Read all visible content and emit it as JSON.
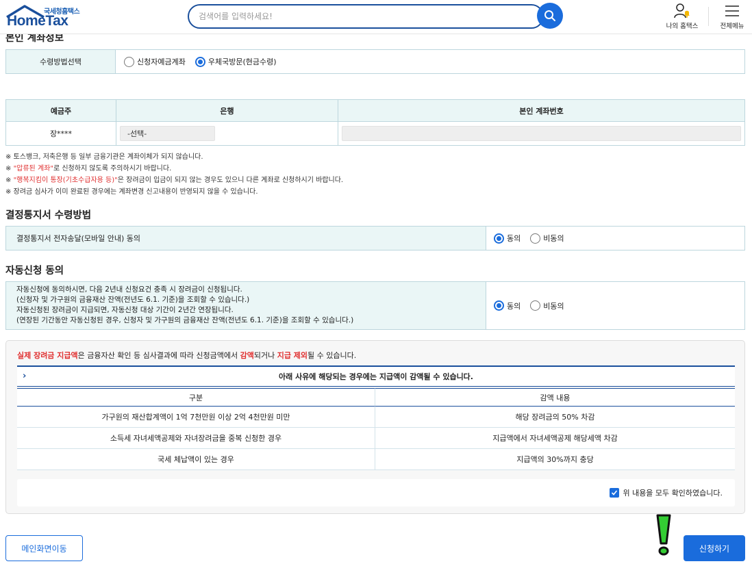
{
  "header": {
    "logo_sub": "국세청홈택스",
    "logo_main": "HomeTax",
    "search_placeholder": "검색어를 입력하세요!",
    "my_hometax": "나의 홈택스",
    "all_menu": "전체메뉴"
  },
  "account_section": {
    "title": "본인 계좌정보",
    "method_label": "수령방법선택",
    "options": [
      "신청자예금계좌",
      "우체국방문(현금수령)"
    ],
    "selected_option": "우체국방문(현금수령)",
    "columns": [
      "예금주",
      "은행",
      "본인 계좌번호"
    ],
    "holder": "장****",
    "bank_select": "-선택-",
    "account_number": ""
  },
  "notes": {
    "n1": "※ 토스뱅크, 저축은행 등 일부 금융기관은 계좌이체가 되지 않습니다.",
    "n2_prefix": "※ ",
    "n2_red": "\"압류된 계좌\"",
    "n2_suffix": "로 신청하지 않도록 주의하시기 바랍니다.",
    "n3_prefix": "※ ",
    "n3_red": "\"행복지킴이 통장(기초수급자용 등)\"",
    "n3_suffix": "은 장려금이 입금이 되지 않는 경우도 있으니 다른 계좌로 신청하시기 바랍니다.",
    "n4": "※ 장려금 심사가 이미 완료된 경우에는 계좌변경 신고내용이 반영되지 않을 수 있습니다."
  },
  "notice_method": {
    "title": "결정통지서 수령방법",
    "label": "결정통지서 전자송달(모바일 안내) 동의",
    "agree": "동의",
    "disagree": "비동의",
    "selected": "동의"
  },
  "auto_apply": {
    "title": "자동신청 동의",
    "lines": [
      "자동신청에 동의하시면, 다음 2년내 신청요건 충족 시 장려금이 신청됩니다.",
      "(신청자 및 가구원의 금융재산 잔액(전년도 6.1. 기준)을 조회할 수 있습니다.)",
      "자동신청된 장려금이 지급되면, 자동신청 대상 기간이 2년간 연장됩니다.",
      "(연장된 기간동안 자동신청된 경우, 신청자 및 가구원의 금융재산 잔액(전년도 6.1. 기준)을 조회할 수 있습니다.)"
    ],
    "agree": "동의",
    "disagree": "비동의",
    "selected": "동의"
  },
  "panel": {
    "intro_red1": "실제 장려금 지급액",
    "intro_mid1": "은 금융자산 확인 등 심사결과에 따라 신청금액에서 ",
    "intro_red2": "감액",
    "intro_mid2": "되거나 ",
    "intro_red3": "지급 제외",
    "intro_end": "될 수 있습니다.",
    "reduce_header": "아래 사유에 해당되는 경우에는 지급액이 감액될 수 있습니다.",
    "columns": [
      "구분",
      "감액 내용"
    ],
    "rows": [
      [
        "가구원의 재산합계액이 1억 7천만원 이상 2억 4천만원 미만",
        "해당 장려금의 50% 차감"
      ],
      [
        "소득세 자녀세액공제와 자녀장려금을 중복 신청한 경우",
        "지급액에서 자녀세액공제 해당세액 차감"
      ],
      [
        "국세 체납액이 있는 경우",
        "지급액의 30%까지 충당"
      ]
    ],
    "confirm_label": "위 내용을 모두 확인하였습니다.",
    "confirm_checked": true
  },
  "buttons": {
    "main": "메인화면이동",
    "apply": "신청하기"
  },
  "colors": {
    "brand": "#1a6cdc",
    "header_bg": "#eaf6f6",
    "alert_green": "#33cc33"
  }
}
